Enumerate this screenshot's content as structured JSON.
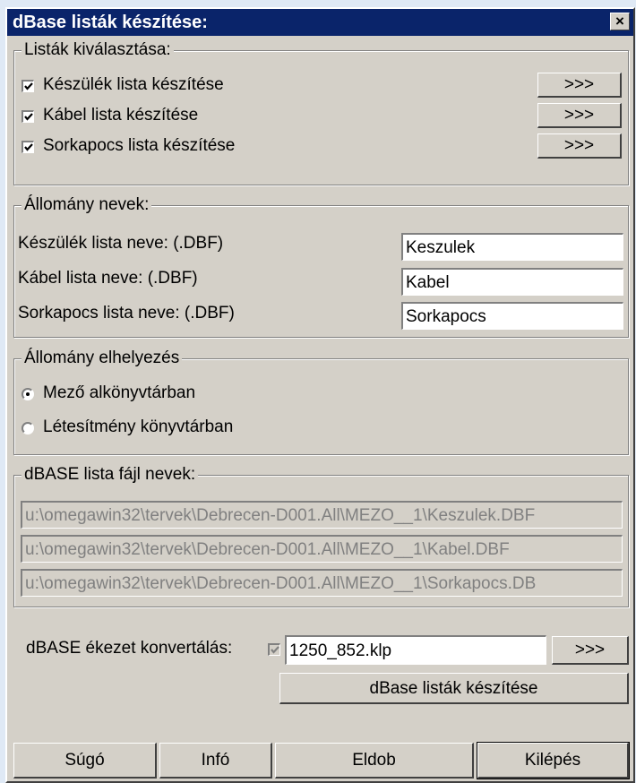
{
  "window": {
    "title": "dBase listák készítése:",
    "close_glyph": "×"
  },
  "lists_group": {
    "legend": "Listák kiválasztása:",
    "items": [
      {
        "label": "Készülék lista készítése",
        "checked": true,
        "button": ">>>"
      },
      {
        "label": "Kábel lista készítése",
        "checked": true,
        "button": ">>>"
      },
      {
        "label": "Sorkapocs lista készítése",
        "checked": true,
        "button": ">>>"
      }
    ]
  },
  "names_group": {
    "legend": "Állomány nevek:",
    "rows": [
      {
        "label": "Készülék lista neve: (.DBF)",
        "value": "Keszulek"
      },
      {
        "label": "Kábel lista neve: (.DBF)",
        "value": "Kabel"
      },
      {
        "label": "Sorkapocs lista neve: (.DBF)",
        "value": "Sorkapocs"
      }
    ]
  },
  "placement_group": {
    "legend": "Állomány elhelyezés",
    "options": [
      {
        "label": "Mező alkönyvtárban",
        "selected": true
      },
      {
        "label": "Létesítmény könyvtárban",
        "selected": false
      }
    ]
  },
  "files_group": {
    "legend": "dBASE lista fájl nevek:",
    "paths": [
      "u:\\omegawin32\\tervek\\Debrecen-D001.All\\MEZO__1\\Keszulek.DBF",
      "u:\\omegawin32\\tervek\\Debrecen-D001.All\\MEZO__1\\Kabel.DBF",
      "u:\\omegawin32\\tervek\\Debrecen-D001.All\\MEZO__1\\Sorkapocs.DB"
    ]
  },
  "conversion": {
    "label": "dBASE ékezet konvertálás:",
    "checked": true,
    "value": "1250_852.klp",
    "button": ">>>"
  },
  "create_button": "dBase listák készítése",
  "footer": {
    "help": "Súgó",
    "info": "Infó",
    "discard": "Eldob",
    "exit": "Kilépés"
  }
}
